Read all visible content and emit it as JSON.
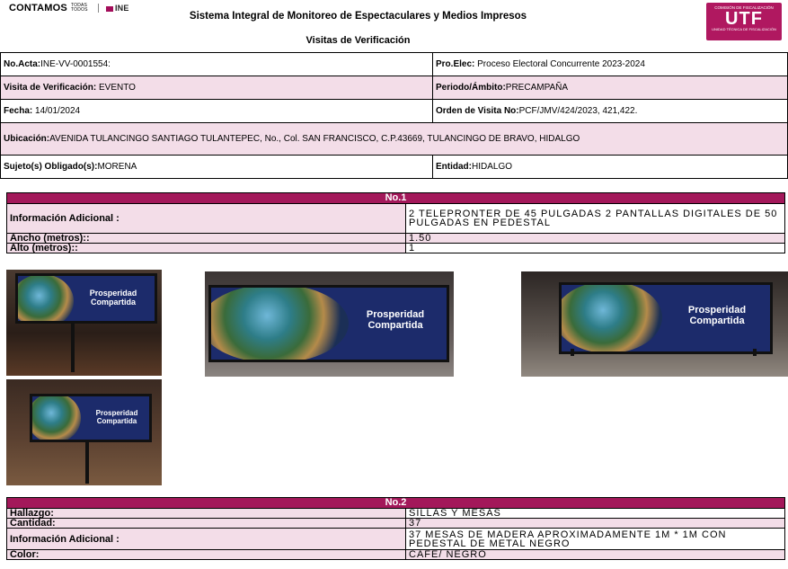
{
  "header": {
    "left_logo": "CONTAMOS",
    "left_logo_small": "TODAS TODOS",
    "ine": "INE",
    "title": "Sistema Integral de Monitoreo de Espectaculares y Medios Impresos",
    "subtitle": "Visitas de Verificación",
    "utf_top": "COMISIÓN DE FISCALIZACIÓN",
    "utf": "UTF",
    "utf_bottom": "UNIDAD TÉCNICA DE FISCALIZACIÓN"
  },
  "info": {
    "acta_label": "No.Acta:",
    "acta_value": "INE-VV-0001554:",
    "proelec_label": "Pro.Elec:",
    "proelec_value": " Proceso Electoral Concurrente 2023-2024",
    "visita_label": "Visita de Verificación:",
    "visita_value": " EVENTO",
    "periodo_label": "Periodo/Ámbito:",
    "periodo_value": "PRECAMPAÑA",
    "fecha_label": "Fecha:",
    "fecha_value": " 14/01/2024",
    "orden_label": "Orden de Visita No:",
    "orden_value": "PCF/JMV/424/2023, 421,422.",
    "ubicacion_label": "Ubicación:",
    "ubicacion_value": "AVENIDA TULANCINGO SANTIAGO TULANTEPEC, No., Col. SAN FRANCISCO, C.P.43669, TULANCINGO DE BRAVO, HIDALGO",
    "sujeto_label": "Sujeto(s) Obligado(s):",
    "sujeto_value": "MORENA",
    "entidad_label": "Entidad:",
    "entidad_value": "HIDALGO"
  },
  "item1": {
    "header": "No.1",
    "info_label": "Información Adicional :",
    "info_value": "2 TELEPRONTER DE 45 PULGADAS 2 PANTALLAS DIGITALES DE 50 PULGADAS EN PEDESTAL",
    "ancho_label": "Ancho (metros)::",
    "ancho_value": "1.50",
    "alto_label": "Alto (metros)::",
    "alto_value": "1"
  },
  "photos": {
    "screen_text": "Prosperidad Compartida"
  },
  "item2": {
    "header": "No.2",
    "hallazgo_label": "Hallazgo:",
    "hallazgo_value": "SILLAS Y MESAS",
    "cantidad_label": "Cantidad:",
    "cantidad_value": "37",
    "info_label": "Información Adicional :",
    "info_value": "37 MESAS DE MADERA APROXIMADAMENTE 1M * 1M CON PEDESTAL DE METAL NEGRO",
    "color_label": "Color:",
    "color_value": "CAFE/ NEGRO"
  },
  "colors": {
    "accent": "#a3185a",
    "pink_row": "#f3dde8"
  }
}
